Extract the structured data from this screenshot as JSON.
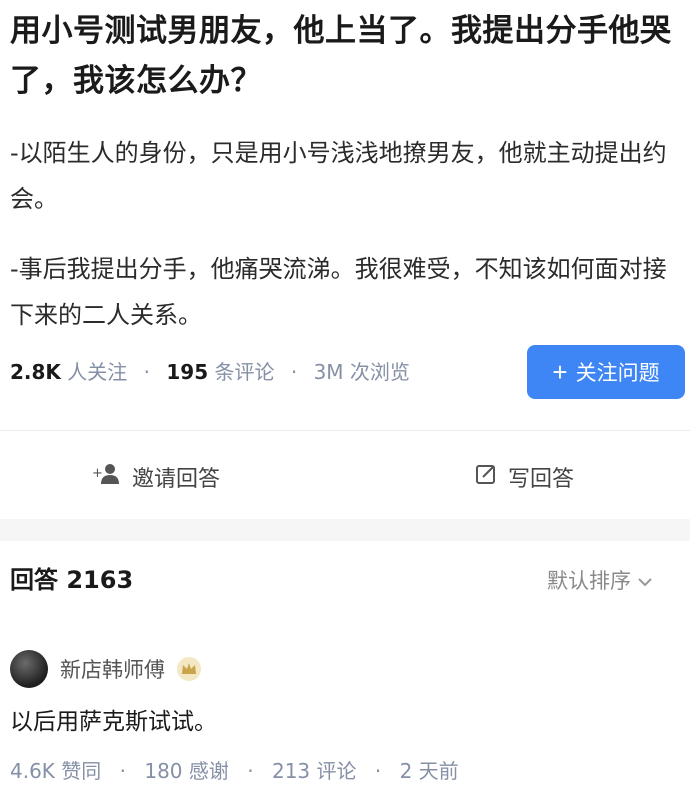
{
  "question": {
    "title": "用小号测试男朋友，他上当了。我提出分手他哭了，我该怎么办？",
    "description_1": "-以陌生人的身份，只是用小号浅浅地撩男友，他就主动提出约会。",
    "description_2": "-事后我提出分手，他痛哭流涕。我很难受，不知该如何面对接下来的二人关系。"
  },
  "stats": {
    "followers_num": "2.8K",
    "followers_label": "人关注",
    "comments_num": "195",
    "comments_label": "条评论",
    "views_num": "3M",
    "views_label": "次浏览",
    "separator": "·"
  },
  "follow_button": {
    "icon": "plus-icon",
    "label": "关注问题",
    "color": "#3e86f5"
  },
  "actions": {
    "invite": {
      "icon": "invite-user-icon",
      "label": "邀请回答"
    },
    "write": {
      "icon": "edit-icon",
      "label": "写回答"
    }
  },
  "answers": {
    "header": "回答 2163",
    "sort_label": "默认排序",
    "sort_icon": "chevron-down-icon"
  },
  "answer": {
    "author": "新店韩师傅",
    "badge_icon": "crown-badge-icon",
    "text": "以后用萨克斯试试。",
    "likes": "4.6K 赞同",
    "thanks": "180 感谢",
    "comments": "213 评论",
    "time": "2 天前"
  }
}
